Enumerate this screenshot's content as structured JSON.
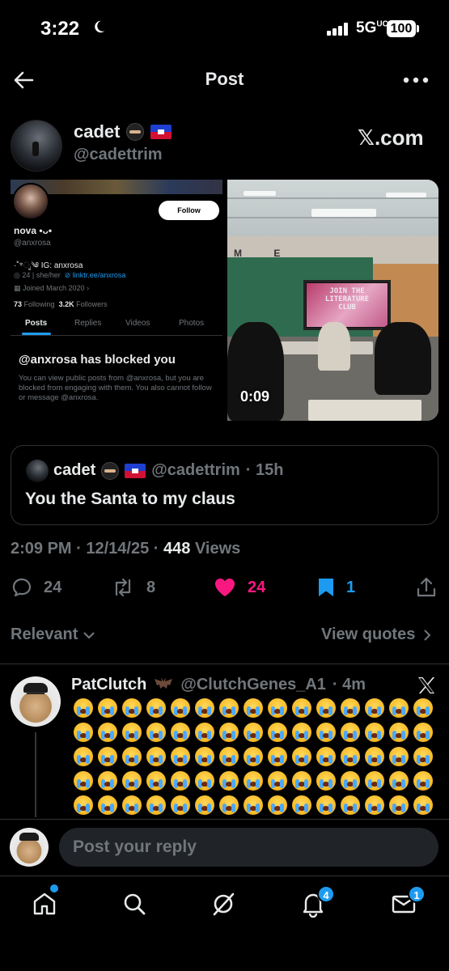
{
  "status_bar": {
    "time": "3:22",
    "network": "5G",
    "network_sup": "UC",
    "battery": "100"
  },
  "header": {
    "title": "Post",
    "back_icon": "back-arrow-icon",
    "more_icon": "more-icon"
  },
  "post": {
    "author_name": "cadet",
    "author_handle": "@cadettrim",
    "source_badge": "𝕏.com",
    "media_left": {
      "follow_label": "Follow",
      "name": "nova •ᴗ•",
      "handle": "@anxrosa",
      "bio": "·˚*ೃ༄ IG: anxrosa",
      "meta_age": "24 | she/her",
      "meta_link": "linktr.ee/anxrosa",
      "joined": "Joined March 2020",
      "following_count": "73",
      "following_label": "Following",
      "followers_count": "3.2K",
      "followers_label": "Followers",
      "tabs": [
        "Posts",
        "Replies",
        "Videos",
        "Photos"
      ],
      "blocked_title": "@anxrosa has blocked you",
      "blocked_text": "You can view public posts from @anxrosa, but you are blocked from engaging with them. You also cannot follow or message @anxrosa."
    },
    "media_right": {
      "screen_text_1": "JOIN THE",
      "screen_text_2": "LITERATURE",
      "screen_text_3": "CLUB",
      "letters": "M E",
      "duration": "0:09"
    },
    "quote": {
      "name": "cadet",
      "handle": "@cadettrim",
      "time": "· 15h",
      "text": "You the Santa to my claus"
    },
    "timestamp": "2:09 PM · 12/14/25 ·",
    "views_count": "448",
    "views_label": "Views",
    "actions": {
      "replies": "24",
      "reposts": "8",
      "likes": "24",
      "bookmarks": "1"
    }
  },
  "sort": {
    "label": "Relevant",
    "view_quotes": "View quotes"
  },
  "reply": {
    "name": "PatClutch",
    "handle": "@ClutchGenes_A1",
    "time": "· 4m",
    "emoji_name": "loudly-crying-face",
    "emoji_count": 75
  },
  "composer": {
    "placeholder": "Post your reply"
  },
  "bottom_nav": {
    "items": [
      "home-icon",
      "search-icon",
      "grok-icon",
      "notifications-icon",
      "messages-icon"
    ],
    "notifications_badge": "4",
    "messages_badge": "1"
  },
  "colors": {
    "accent": "#1d9bf0",
    "like": "#f91880",
    "muted": "#71767b",
    "background": "#000000"
  }
}
